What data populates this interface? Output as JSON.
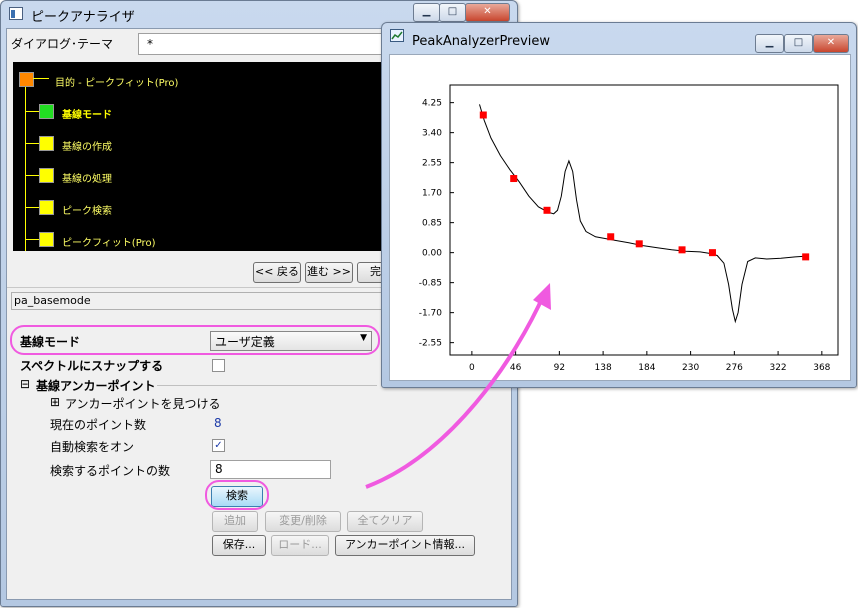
{
  "main_window": {
    "title": "ピークアナライザ",
    "dialog_theme_label": "ダイアログ･テーマ",
    "dialog_theme_value": "*",
    "tree": {
      "root": "目的 - ピークフィット(Pro)",
      "steps": [
        {
          "label": "基線モード",
          "active": true
        },
        {
          "label": "基線の作成",
          "active": false
        },
        {
          "label": "基線の処理",
          "active": false
        },
        {
          "label": "ピーク検索",
          "active": false
        },
        {
          "label": "ピークフィット(Pro)",
          "active": false
        }
      ]
    },
    "nav": {
      "back": "<< 戻る",
      "next": "進む >>",
      "finish": "完了"
    },
    "page_name": "pa_basemode",
    "baseline_mode_label": "基線モード",
    "baseline_mode_value": "ユーザ定義",
    "snap_label": "スペクトルにスナップする",
    "anchor_section": "基線アンカーポイント",
    "find_anchor": "アンカーポイントを見つける",
    "current_points_label": "現在のポイント数",
    "current_points_value": "8",
    "auto_find_label": "自動検索をオン",
    "search_points_label": "検索するポイントの数",
    "search_points_value": "8",
    "buttons": {
      "search": "検索",
      "add": "追加",
      "modify": "変更/削除",
      "clear_all": "全てクリア",
      "save": "保存...",
      "load": "ロード...",
      "anchor_info": "アンカーポイント情報..."
    }
  },
  "preview_window": {
    "title": "PeakAnalyzerPreview"
  },
  "colors": {
    "highlight": "#f05ae0",
    "anchor_point": "#ff0000",
    "active_node": "#22dd22",
    "node": "#ffff00",
    "root_node": "#ff8800"
  },
  "chart_data": {
    "type": "line",
    "x_ticks": [
      "0",
      "46",
      "92",
      "138",
      "184",
      "230",
      "276",
      "322",
      "368"
    ],
    "y_ticks": [
      "4.25",
      "3.40",
      "2.55",
      "1.70",
      "0.85",
      "0.00",
      "-0.85",
      "-1.70",
      "-2.55"
    ],
    "xlim": [
      -23,
      385
    ],
    "ylim": [
      -2.9,
      4.75
    ],
    "grid": false,
    "series": [
      {
        "curve": [
          [
            8,
            4.2
          ],
          [
            13,
            3.75
          ],
          [
            20,
            3.25
          ],
          [
            30,
            2.75
          ],
          [
            40,
            2.35
          ],
          [
            50,
            2.0
          ],
          [
            60,
            1.6
          ],
          [
            70,
            1.3
          ],
          [
            80,
            1.15
          ],
          [
            86,
            1.1
          ],
          [
            90,
            1.2
          ],
          [
            94,
            1.6
          ],
          [
            98,
            2.3
          ],
          [
            102,
            2.6
          ],
          [
            106,
            2.3
          ],
          [
            110,
            1.5
          ],
          [
            114,
            0.9
          ],
          [
            120,
            0.6
          ],
          [
            130,
            0.45
          ],
          [
            140,
            0.4
          ],
          [
            150,
            0.35
          ],
          [
            165,
            0.28
          ],
          [
            180,
            0.2
          ],
          [
            195,
            0.14
          ],
          [
            210,
            0.08
          ],
          [
            225,
            0.04
          ],
          [
            240,
            0.02
          ],
          [
            250,
            -0.02
          ],
          [
            258,
            -0.08
          ],
          [
            265,
            -0.3
          ],
          [
            270,
            -0.9
          ],
          [
            274,
            -1.6
          ],
          [
            277,
            -1.95
          ],
          [
            280,
            -1.7
          ],
          [
            284,
            -0.9
          ],
          [
            290,
            -0.25
          ],
          [
            298,
            -0.15
          ],
          [
            310,
            -0.18
          ],
          [
            325,
            -0.16
          ],
          [
            340,
            -0.12
          ],
          [
            350,
            -0.1
          ]
        ],
        "anchors": [
          [
            12,
            3.9
          ],
          [
            44,
            2.1
          ],
          [
            79,
            1.2
          ],
          [
            146,
            0.45
          ],
          [
            176,
            0.25
          ],
          [
            221,
            0.08
          ],
          [
            253,
            0.0
          ],
          [
            351,
            -0.12
          ]
        ]
      }
    ]
  }
}
